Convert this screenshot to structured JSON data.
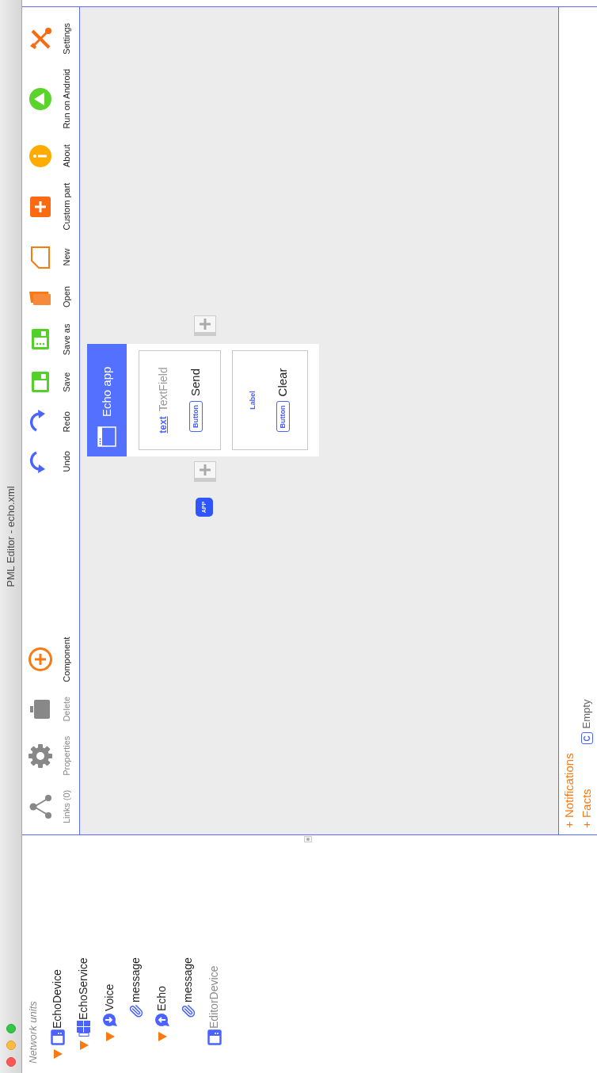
{
  "window": {
    "title": "PML Editor - echo.xml"
  },
  "sidebar": {
    "heading": "Network units",
    "tree": [
      {
        "label": "EchoDevice",
        "kind": "device",
        "disabled": false,
        "expanded": true,
        "children": [
          {
            "label": "EchoService",
            "kind": "service",
            "disabled": false,
            "expanded": true,
            "children": [
              {
                "label": "Voice",
                "kind": "input",
                "disabled": false,
                "expanded": true,
                "children": [
                  {
                    "label": "message",
                    "kind": "message",
                    "disabled": false
                  }
                ]
              },
              {
                "label": "Echo",
                "kind": "output",
                "disabled": false,
                "expanded": true,
                "children": [
                  {
                    "label": "message",
                    "kind": "message",
                    "disabled": false
                  }
                ]
              }
            ]
          }
        ]
      },
      {
        "label": "EditorDevice",
        "kind": "device",
        "disabled": true
      }
    ]
  },
  "toolbar": {
    "left": [
      {
        "label": "Links (0)",
        "disabled": true
      },
      {
        "label": "Properties",
        "disabled": true
      },
      {
        "label": "Delete",
        "disabled": true
      },
      {
        "label": "Component",
        "disabled": false
      }
    ],
    "right": [
      {
        "label": "Undo",
        "disabled": false
      },
      {
        "label": "Redo",
        "disabled": false
      },
      {
        "label": "Save",
        "disabled": false
      },
      {
        "label": "Save as",
        "disabled": false
      },
      {
        "label": "Open",
        "disabled": false
      },
      {
        "label": "New",
        "disabled": false
      },
      {
        "label": "Custom part",
        "disabled": false
      },
      {
        "label": "About",
        "disabled": false
      },
      {
        "label": "Run on Android",
        "disabled": false
      },
      {
        "label": "Settings",
        "disabled": false
      }
    ]
  },
  "canvas": {
    "app_badge": "APP",
    "app_card": {
      "title": "Echo app",
      "rows": [
        {
          "lines": [
            [
              {
                "kind": "binding",
                "text": "text"
              },
              {
                "kind": "type-name",
                "text": "TextField"
              }
            ],
            [
              {
                "kind": "type-badge",
                "text": "Button"
              },
              {
                "kind": "caption",
                "text": "Send"
              }
            ]
          ]
        },
        {
          "lines": [
            [
              {
                "kind": "type-tag",
                "text": "Label"
              }
            ],
            [
              {
                "kind": "type-badge",
                "text": "Button"
              },
              {
                "kind": "caption",
                "text": "Clear"
              }
            ]
          ]
        }
      ]
    }
  },
  "bottom": {
    "notifications": "+ Notifications",
    "facts": "+ Facts",
    "facts_badge": "C",
    "facts_status": "Empty"
  }
}
